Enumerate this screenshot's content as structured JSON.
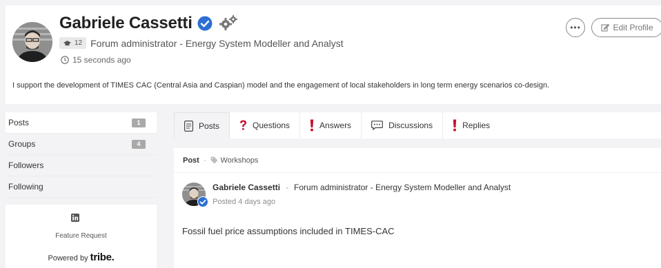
{
  "profile": {
    "name": "Gabriele Cassetti",
    "reputation": "12",
    "role": "Forum administrator - Energy System Modeller and Analyst",
    "last_seen": "15 seconds ago",
    "bio": "I support the development of TIMES CAC (Central Asia and Caspian) model and the engagement of local stakeholders in long term energy scenarios co-design.",
    "more_label": "•••",
    "edit_label": "Edit Profile",
    "verified_color": "#2d6fd3"
  },
  "sidebar": {
    "items": [
      {
        "label": "Posts",
        "count": "1"
      },
      {
        "label": "Groups",
        "count": "4"
      },
      {
        "label": "Followers",
        "count": ""
      },
      {
        "label": "Following",
        "count": ""
      }
    ],
    "feature_request": "Feature Request",
    "powered_prefix": "Powered by",
    "powered_brand": "tribe."
  },
  "tabs": [
    {
      "label": "Posts",
      "icon": "document-icon"
    },
    {
      "label": "Questions",
      "icon": "question-icon"
    },
    {
      "label": "Answers",
      "icon": "exclamation-icon"
    },
    {
      "label": "Discussions",
      "icon": "chat-icon"
    },
    {
      "label": "Replies",
      "icon": "exclamation-icon"
    }
  ],
  "post": {
    "type_label": "Post",
    "separator": "·",
    "tag": "Workshops",
    "author": "Gabriele Cassetti",
    "author_separator": "·",
    "author_role": "Forum administrator - Energy System Modeller and Analyst",
    "posted": "Posted 4 days ago",
    "title": "Fossil fuel price assumptions included in TIMES-CAC"
  },
  "colors": {
    "accent_red": "#c8102e",
    "verified_blue": "#2d6fd3"
  }
}
